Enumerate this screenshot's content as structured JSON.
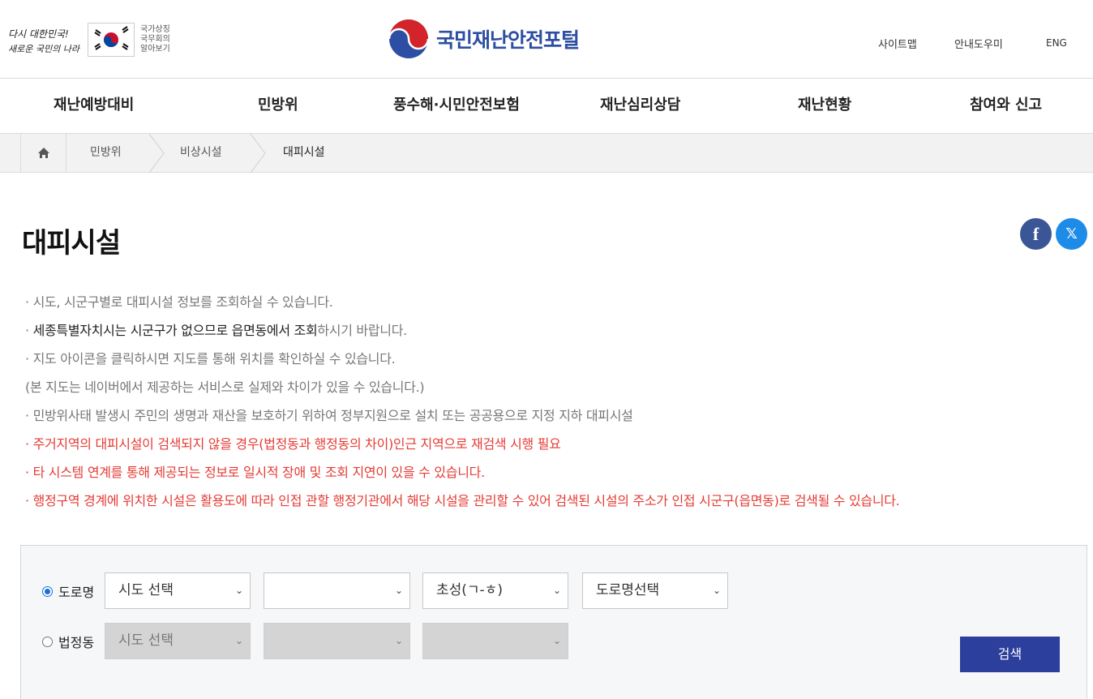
{
  "header": {
    "slogan_line1": "다시 대한민국!",
    "slogan_line2": "새로운 국민의 나라",
    "flag_text": [
      "국가상징",
      "국무회의",
      "알아보기"
    ],
    "logo_title": "국민재난안전포털",
    "util_links": [
      "사이트맵",
      "안내도우미",
      "ENG"
    ]
  },
  "gnb": [
    "재난예방대비",
    "민방위",
    "풍수해·시민안전보험",
    "재난심리상담",
    "재난현황",
    "참여와 신고"
  ],
  "breadcrumb": [
    "민방위",
    "비상시설",
    "대피시설"
  ],
  "page_title": "대피시설",
  "share": {
    "facebook": "f",
    "x": "𝕏"
  },
  "notices": {
    "n1": "· 시도, 시군구별로 대피시설 정보를 조회하실 수 있습니다.",
    "n2_prefix": "· ",
    "n2_dark": "세종특별자치시는 시군구가 없으므로 읍면동에서 조회",
    "n2_suffix": "하시기 바랍니다.",
    "n3": "· 지도 아이콘을 클릭하시면 지도를 통해 위치를 확인하실 수 있습니다.",
    "n4": "(본 지도는 네이버에서 제공하는 서비스로 실제와 차이가 있을 수 있습니다.)",
    "n5": "· 민방위사태 발생시 주민의 생명과 재산을 보호하기 위하여 정부지원으로 설치 또는 공공용으로 지정 지하 대피시설",
    "n6": "· 주거지역의 대피시설이 검색되지 않을 경우(법정동과 행정동의 차이)인근 지역으로 재검색 시행 필요",
    "n7": "· 타 시스템 연계를 통해 제공되는 정보로 일시적 장애 및 조회 지연이 있을 수 있습니다.",
    "n8": "· 행정구역 경계에 위치한 시설은 활용도에 따라 인접 관할 행정기관에서 해당 시설을 관리할 수 있어 검색된 시설의 주소가 인접 시군구(읍면동)로 검색될 수 있습니다."
  },
  "search": {
    "road_label": "도로명",
    "legal_label": "법정동",
    "road_selects": [
      "시도 선택",
      "",
      "초성(ㄱ-ㅎ)",
      "도로명선택"
    ],
    "legal_selects": [
      "시도 선택",
      "",
      ""
    ],
    "button_label": "검색"
  },
  "colors": {
    "brand_blue": "#2d4ea2",
    "warning_red": "#e53b34",
    "button": "#2d3f9c"
  }
}
